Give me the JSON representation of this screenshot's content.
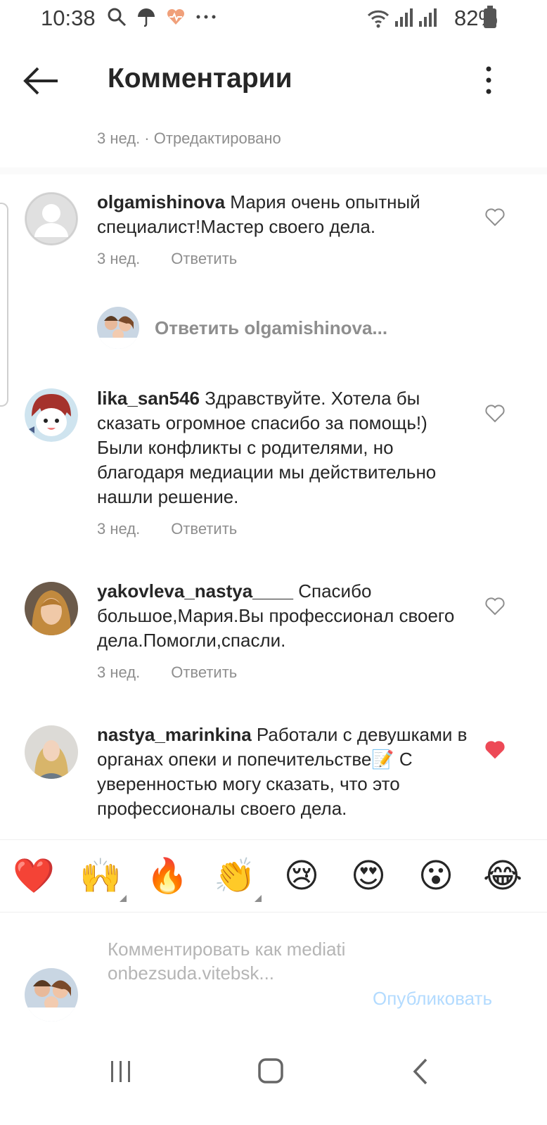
{
  "status_bar": {
    "time": "10:38",
    "battery_percent": "82%",
    "icons": [
      "search-icon",
      "umbrella-icon",
      "health-icon",
      "more-icon",
      "wifi-icon",
      "signal-icon",
      "battery-icon"
    ]
  },
  "header": {
    "title": "Комментарии"
  },
  "post_meta": "3 нед. · Отредактировано",
  "comments": [
    {
      "username": "olgamishinova",
      "text": " Мария очень опытный специалист!Мастер своего дела.",
      "time": "3 нед.",
      "reply_label": "Ответить",
      "liked": false
    },
    {
      "username": "lika_san546",
      "text": " Здравствуйте. Хотела бы сказать огромное спасибо за помощь!) Были конфликты с родителями, но благодаря медиации мы действительно нашли решение.",
      "time": "3 нед.",
      "reply_label": "Ответить",
      "liked": false
    },
    {
      "username": "yakovleva_nastya____",
      "text": " Спасибо большое,Мария.Вы профессионал своего дела.Помогли,спасли.",
      "time": "3 нед.",
      "reply_label": "Ответить",
      "liked": false
    },
    {
      "username": "nastya_marinkina",
      "text": " Работали с девушками в органах опеки и попечительстве📝 С уверенностью могу сказать, что это профессионалы своего дела.",
      "liked": true
    }
  ],
  "reply_prompt": "Ответить olgamishinova...",
  "emoji_bar": [
    "❤️",
    "🙌",
    "🔥",
    "👏",
    "😢",
    "😍",
    "😮",
    "😂"
  ],
  "composer": {
    "placeholder": "Комментировать как mediationbezsuda.vitebsk...",
    "publish_label": "Опубликовать"
  },
  "colors": {
    "liked_heart": "#ed4956",
    "publish_disabled": "#b3dbff",
    "secondary_text": "#8e8e8e"
  }
}
